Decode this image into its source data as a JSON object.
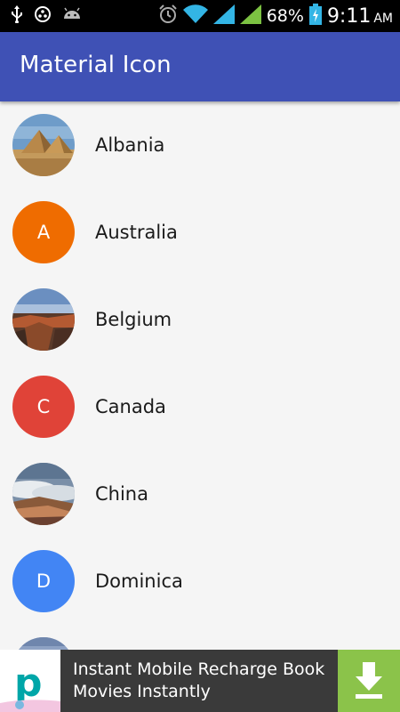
{
  "status_bar": {
    "battery_percent": "68%",
    "time": "9:11",
    "ampm": "AM",
    "icons": [
      "usb-icon",
      "record-icon",
      "android-icon",
      "alarm-icon",
      "wifi-icon",
      "signal-icon",
      "signal-icon",
      "battery-charging-icon"
    ]
  },
  "app_bar": {
    "title": "Material Icon",
    "color": "#3f51b5"
  },
  "list": {
    "items": [
      {
        "name": "Albania",
        "avatar": "image",
        "image": "pyramids"
      },
      {
        "name": "Australia",
        "avatar": "letter",
        "letter": "A",
        "color": "#ef6c00"
      },
      {
        "name": "Belgium",
        "avatar": "image",
        "image": "canyon"
      },
      {
        "name": "Canada",
        "avatar": "letter",
        "letter": "C",
        "color": "#e04338"
      },
      {
        "name": "China",
        "avatar": "image",
        "image": "clouds-mountain"
      },
      {
        "name": "Dominica",
        "avatar": "letter",
        "letter": "D",
        "color": "#4285f4"
      },
      {
        "name": "",
        "avatar": "image",
        "image": "partial"
      }
    ]
  },
  "ad": {
    "text": "Instant Mobile Recharge Book Movies Instantly",
    "logo_letter": "p",
    "download_color": "#8bc34a"
  }
}
